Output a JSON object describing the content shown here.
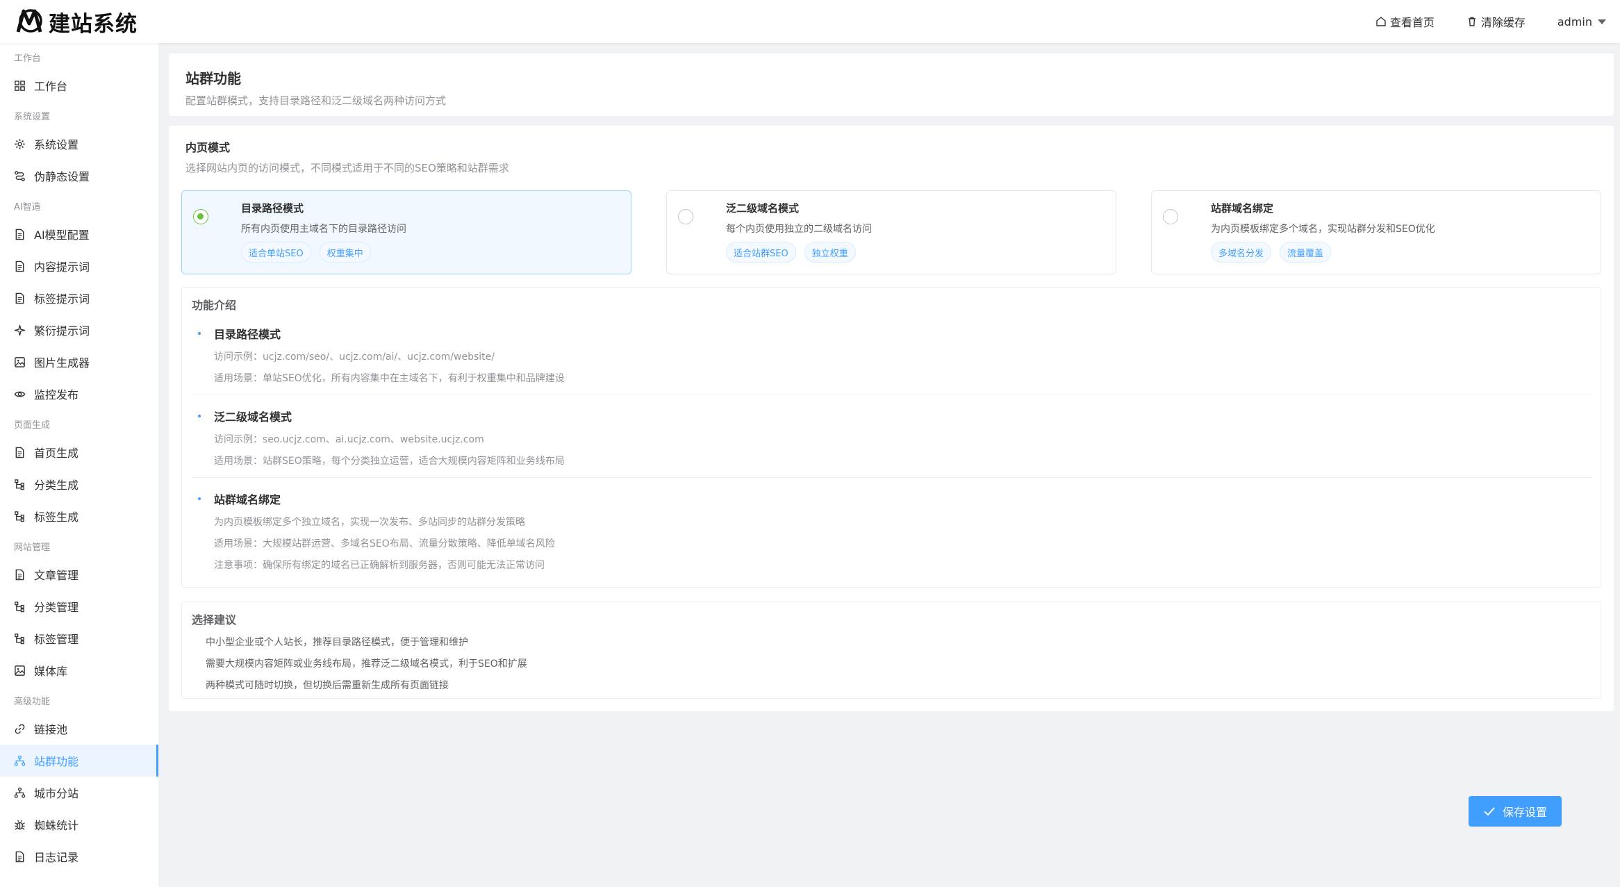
{
  "header": {
    "logo_text": "建站系统",
    "view_home": "查看首页",
    "clear_cache": "清除缓存",
    "user": "admin"
  },
  "sidebar": {
    "groups": [
      {
        "label": "工作台",
        "items": [
          {
            "label": "工作台",
            "icon": "dashboard-icon"
          }
        ]
      },
      {
        "label": "系统设置",
        "items": [
          {
            "label": "系统设置",
            "icon": "gear-icon"
          },
          {
            "label": "伪静态设置",
            "icon": "route-icon"
          }
        ]
      },
      {
        "label": "AI智造",
        "items": [
          {
            "label": "AI模型配置",
            "icon": "document-icon"
          },
          {
            "label": "内容提示词",
            "icon": "document-icon"
          },
          {
            "label": "标签提示词",
            "icon": "document-icon"
          },
          {
            "label": "繁衍提示词",
            "icon": "sparkle-icon"
          },
          {
            "label": "图片生成器",
            "icon": "image-icon"
          },
          {
            "label": "监控发布",
            "icon": "eye-icon"
          }
        ]
      },
      {
        "label": "页面生成",
        "items": [
          {
            "label": "首页生成",
            "icon": "document-icon"
          },
          {
            "label": "分类生成",
            "icon": "tree-icon"
          },
          {
            "label": "标签生成",
            "icon": "tree-icon"
          }
        ]
      },
      {
        "label": "网站管理",
        "items": [
          {
            "label": "文章管理",
            "icon": "document-icon"
          },
          {
            "label": "分类管理",
            "icon": "tree-icon"
          },
          {
            "label": "标签管理",
            "icon": "tree-icon"
          },
          {
            "label": "媒体库",
            "icon": "image-icon"
          }
        ]
      },
      {
        "label": "高级功能",
        "items": [
          {
            "label": "链接池",
            "icon": "link-icon"
          },
          {
            "label": "站群功能",
            "icon": "network-icon",
            "active": true
          },
          {
            "label": "城市分站",
            "icon": "network-icon"
          },
          {
            "label": "蜘蛛统计",
            "icon": "bug-icon"
          },
          {
            "label": "日志记录",
            "icon": "document-icon"
          }
        ]
      }
    ]
  },
  "page": {
    "title": "站群功能",
    "subtitle": "配置站群模式，支持目录路径和泛二级域名两种访问方式"
  },
  "section": {
    "title": "内页模式",
    "subtitle": "选择网站内页的访问模式，不同模式适用于不同的SEO策略和站群需求"
  },
  "modes": [
    {
      "name": "目录路径模式",
      "desc": "所有内页使用主域名下的目录路径访问",
      "tags": [
        "适合单站SEO",
        "权重集中"
      ],
      "selected": true
    },
    {
      "name": "泛二级域名模式",
      "desc": "每个内页使用独立的二级域名访问",
      "tags": [
        "适合站群SEO",
        "独立权重"
      ],
      "selected": false
    },
    {
      "name": "站群域名绑定",
      "desc": "为内页模板绑定多个域名，实现站群分发和SEO优化",
      "tags": [
        "多域名分发",
        "流量覆盖"
      ],
      "selected": false
    }
  ],
  "intro": {
    "title": "功能介绍",
    "items": [
      {
        "title": "目录路径模式",
        "lines": [
          "访问示例：ucjz.com/seo/、ucjz.com/ai/、ucjz.com/website/",
          "适用场景：单站SEO优化，所有内容集中在主域名下，有利于权重集中和品牌建设"
        ]
      },
      {
        "title": "泛二级域名模式",
        "lines": [
          "访问示例：seo.ucjz.com、ai.ucjz.com、website.ucjz.com",
          "适用场景：站群SEO策略，每个分类独立运营，适合大规模内容矩阵和业务线布局"
        ]
      },
      {
        "title": "站群域名绑定",
        "lines": [
          "为内页模板绑定多个独立域名，实现一次发布、多站同步的站群分发策略",
          "适用场景：大规模站群运营、多域名SEO布局、流量分散策略、降低单域名风险",
          "注意事项：确保所有绑定的域名已正确解析到服务器，否则可能无法正常访问"
        ]
      }
    ]
  },
  "advice": {
    "title": "选择建议",
    "lines": [
      "中小型企业或个人站长，推荐目录路径模式，便于管理和维护",
      "需要大规模内容矩阵或业务线布局，推荐泛二级域名模式，利于SEO和扩展",
      "两种模式可随时切换，但切换后需重新生成所有页面链接"
    ]
  },
  "save_label": "保存设置",
  "colors": {
    "primary": "#409eff",
    "selected_radio": "#67c23a",
    "background": "#f0f2f5"
  }
}
